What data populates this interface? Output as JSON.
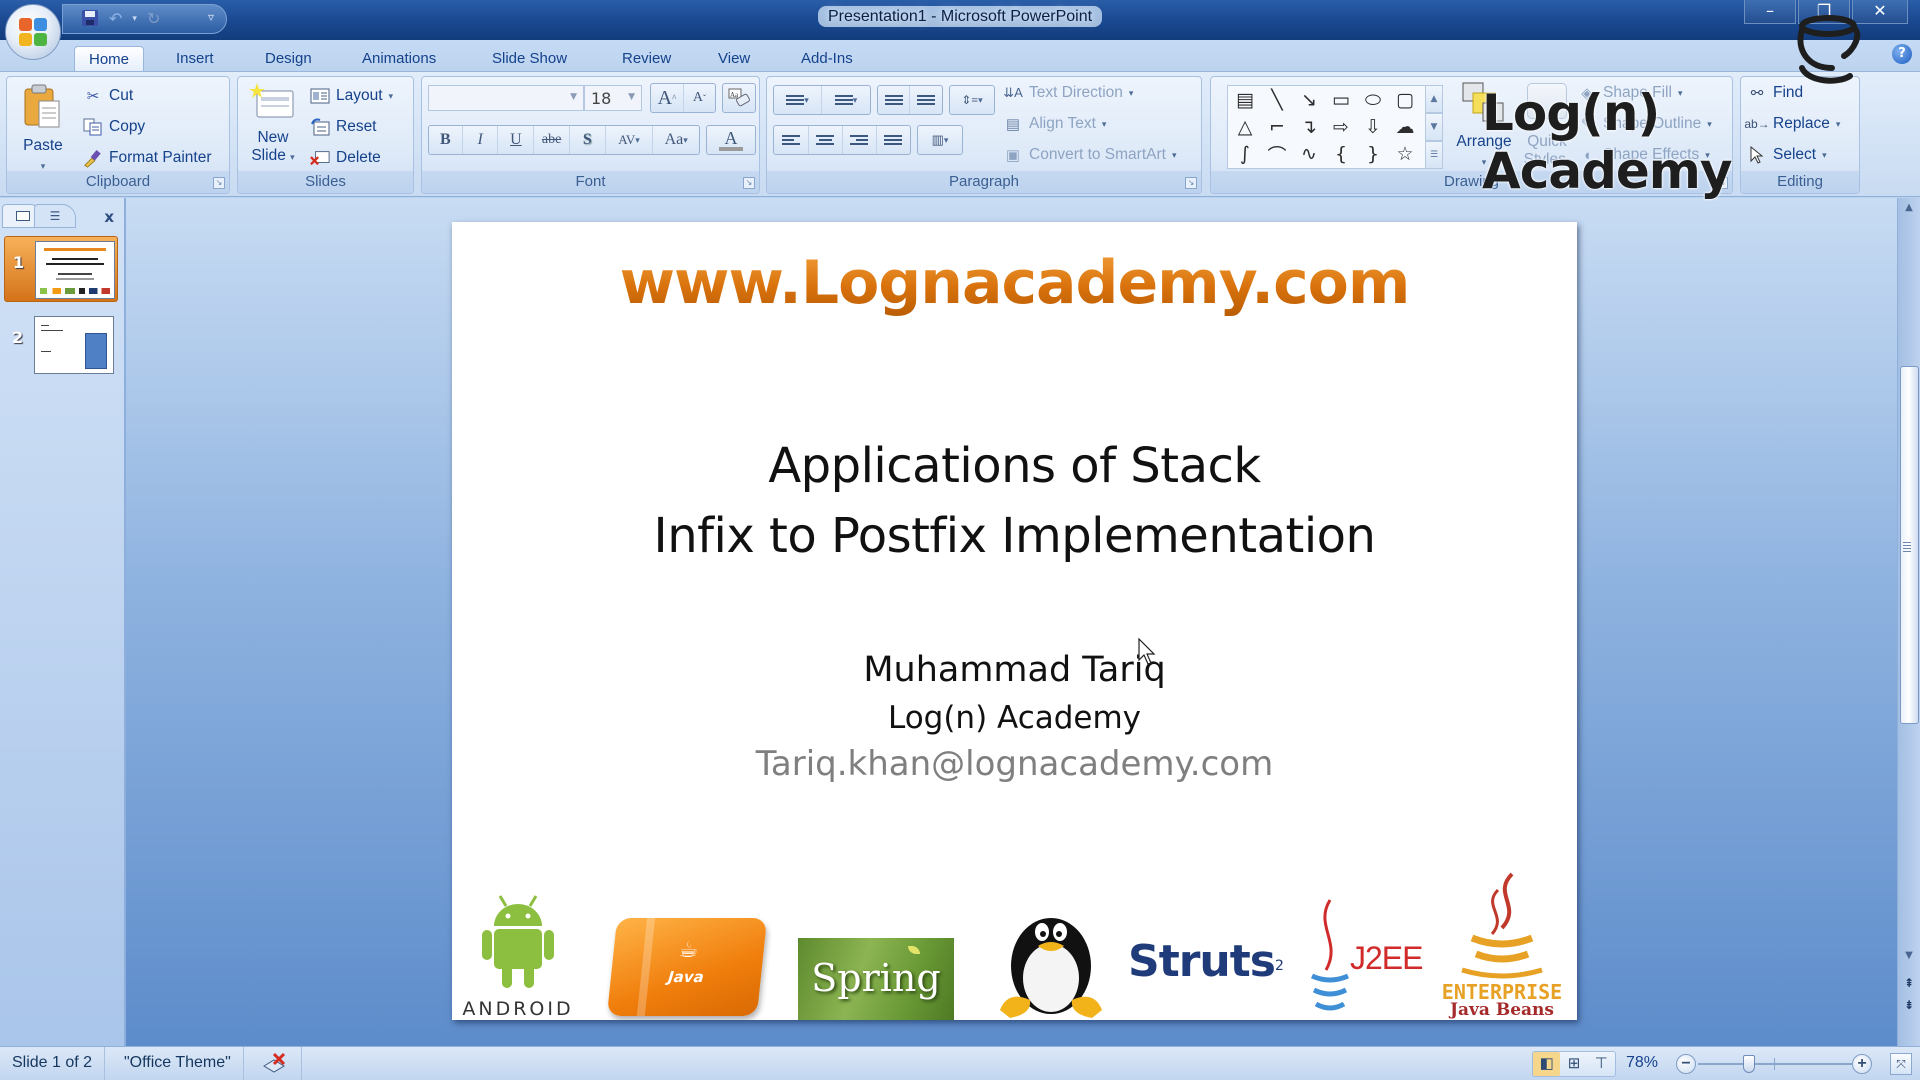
{
  "window": {
    "title": "Presentation1 - Microsoft PowerPoint",
    "controls": {
      "minimize": "–",
      "maximize": "❐",
      "close": "✕"
    }
  },
  "quick_access": {
    "save_icon": "💾",
    "undo_icon": "↶",
    "undo_dropdown": "▾",
    "redo_icon": "↻",
    "customize": "▿"
  },
  "tabs": [
    {
      "label": "Home",
      "active": true
    },
    {
      "label": "Insert"
    },
    {
      "label": "Design"
    },
    {
      "label": "Animations"
    },
    {
      "label": "Slide Show"
    },
    {
      "label": "Review"
    },
    {
      "label": "View"
    },
    {
      "label": "Add-Ins"
    }
  ],
  "help_icon": "?",
  "ribbon": {
    "clipboard": {
      "label": "Clipboard",
      "paste": "Paste",
      "cut": "Cut",
      "copy": "Copy",
      "format_painter": "Format Painter"
    },
    "slides": {
      "label": "Slides",
      "new_slide_line1": "New",
      "new_slide_line2": "Slide",
      "layout": "Layout",
      "reset": "Reset",
      "delete": "Delete"
    },
    "font": {
      "label": "Font",
      "font_name": "",
      "font_size": "18",
      "grow": "A",
      "shrink": "A",
      "bold": "B",
      "italic": "I",
      "underline": "U",
      "strikethrough": "abe",
      "shadow": "S",
      "spacing": "AV",
      "change_case": "Aa",
      "font_color": "A"
    },
    "paragraph": {
      "label": "Paragraph",
      "text_direction": "Text Direction",
      "align_text": "Align Text",
      "convert_smartart": "Convert to SmartArt"
    },
    "drawing": {
      "label": "Drawing",
      "arrange": "Arrange",
      "quick_styles_line1": "Quick",
      "quick_styles_line2": "Styles",
      "shape_fill": "Shape Fill",
      "shape_outline": "Shape Outline",
      "shape_effects": "Shape Effects",
      "shapes": [
        "▤",
        "╲",
        "↘",
        "▭",
        "⬭",
        "▢",
        "△",
        "⌐",
        "↴",
        "⇨",
        "⇩",
        "☁",
        "∫",
        "⌒",
        "∿",
        "{",
        "}",
        "☆"
      ]
    },
    "editing": {
      "label": "Editing",
      "find": "Find",
      "replace": "Replace",
      "select": "Select"
    }
  },
  "watermark": {
    "text": "Log(n) Academy"
  },
  "slide_panel": {
    "close": "x",
    "slides": [
      {
        "number": "1",
        "selected": true
      },
      {
        "number": "2",
        "selected": false
      }
    ]
  },
  "slide": {
    "url": "www.Lognacademy.com",
    "title_line1": "Applications of Stack",
    "title_line2": "Infix to Postfix Implementation",
    "author": "Muhammad Tariq",
    "organization": "Log(n) Academy",
    "email": "Tariq.khan@lognacademy.com",
    "logos": {
      "android": "ANDROID",
      "java": "Java",
      "spring": "Spring",
      "linux": "Tux",
      "struts": "Struts",
      "struts_sup": "2",
      "j2ee": "J2EE",
      "ejb_line1": "ENTERPRISE",
      "ejb_line2": "Java Beans"
    }
  },
  "statusbar": {
    "slide_info": "Slide 1 of 2",
    "theme": "\"Office Theme\"",
    "zoom": "78%",
    "zoom_level_percent": 78,
    "zoom_out": "−",
    "zoom_in": "+"
  },
  "scrollbar": {
    "up": "▲",
    "down": "▼",
    "prev_page": "⇞",
    "next_page": "⇟"
  }
}
